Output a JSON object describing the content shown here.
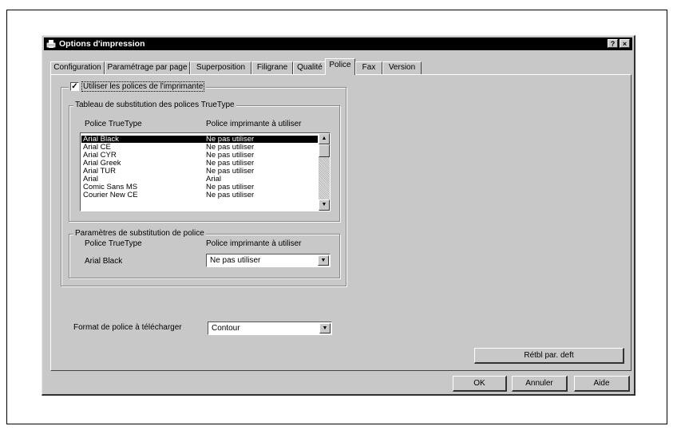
{
  "window": {
    "title": "Options d'impression",
    "help_label": "?",
    "close_label": "×"
  },
  "tabs": [
    {
      "label": "Configuration"
    },
    {
      "label": "Paramétrage par page"
    },
    {
      "label": "Superposition"
    },
    {
      "label": "Filigrane"
    },
    {
      "label": "Qualité"
    },
    {
      "label": "Police"
    },
    {
      "label": "Fax"
    },
    {
      "label": "Version"
    }
  ],
  "active_tab": "Police",
  "use_printer_fonts": {
    "label": "Utiliser les polices de l'imprimante",
    "checked": true,
    "mark": "✓"
  },
  "substitution_table": {
    "title": "Tableau de substitution des polices TrueType",
    "col1": "Police TrueType",
    "col2": "Police imprimante à utiliser",
    "rows": [
      {
        "truetype": "Arial Black",
        "printer": "Ne pas utiliser"
      },
      {
        "truetype": "Arial CE",
        "printer": "Ne pas utiliser"
      },
      {
        "truetype": "Arial CYR",
        "printer": "Ne pas utiliser"
      },
      {
        "truetype": "Arial Greek",
        "printer": "Ne pas utiliser"
      },
      {
        "truetype": "Arial TUR",
        "printer": "Ne pas utiliser"
      },
      {
        "truetype": "Arial",
        "printer": "Arial"
      },
      {
        "truetype": "Comic Sans MS",
        "printer": "Ne pas utiliser"
      },
      {
        "truetype": "Courier New CE",
        "printer": "Ne pas utiliser"
      }
    ],
    "selected_index": 0
  },
  "substitution_params": {
    "title": "Paramètres de substitution de police",
    "col1": "Police TrueType",
    "col2": "Police imprimante à utiliser",
    "font": "Arial Black",
    "printer_font": "Ne pas utiliser"
  },
  "download_format": {
    "label": "Format de police à télécharger",
    "value": "Contour"
  },
  "buttons": {
    "reset": "Rétbl par. deft",
    "ok": "OK",
    "cancel": "Annuler",
    "help": "Aide"
  },
  "icons": {
    "title_icon": "printer-icon",
    "scroll_up": "▲",
    "scroll_down": "▼",
    "dropdown": "▼"
  }
}
